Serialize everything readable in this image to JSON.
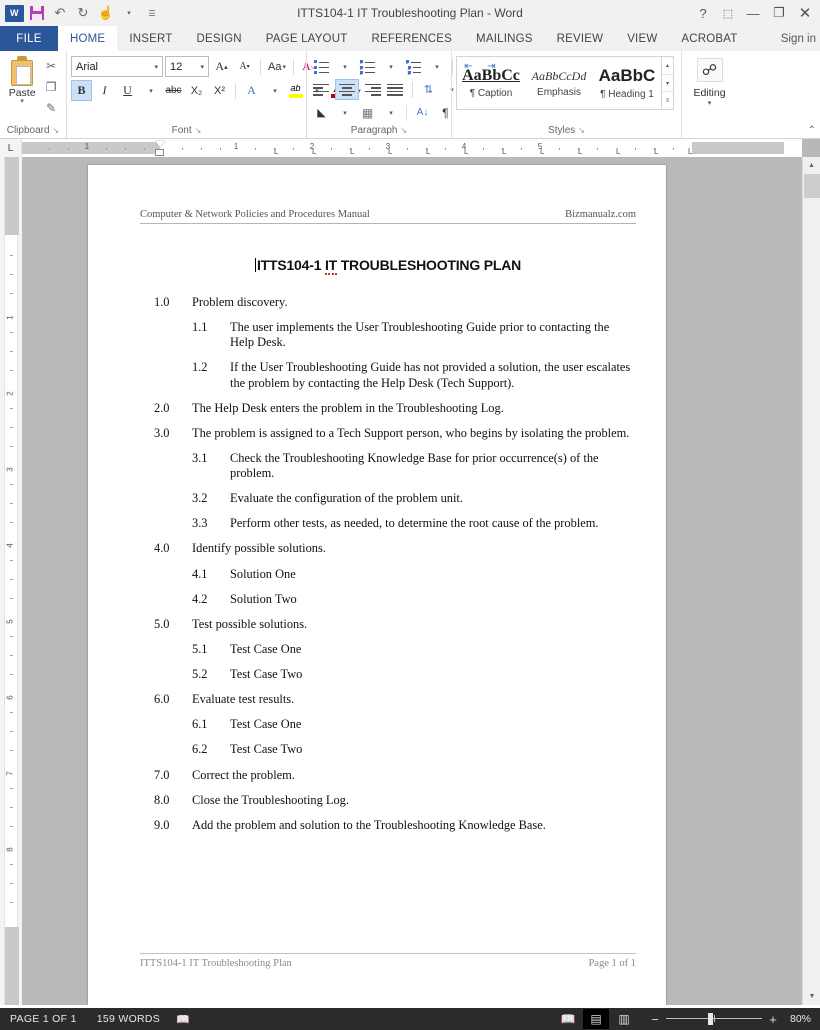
{
  "titlebar": {
    "document_title": "ITTS104-1 IT Troubleshooting Plan - Word",
    "quick_access": [
      {
        "name": "word-logo",
        "glyph": "W"
      },
      {
        "name": "save-icon",
        "glyph": ""
      },
      {
        "name": "undo-icon",
        "glyph": "↶"
      },
      {
        "name": "redo-icon",
        "glyph": "↻"
      },
      {
        "name": "touch-mode-icon",
        "glyph": "☝"
      },
      {
        "name": "customize-qat-icon",
        "glyph": "▾"
      }
    ],
    "help_glyph": "?",
    "ribbon_display_glyph": "⬚",
    "minimize_glyph": "—",
    "restore_glyph": "❐",
    "close_glyph": "✕"
  },
  "tabs": {
    "file_label": "FILE",
    "items": [
      {
        "label": "HOME",
        "active": true
      },
      {
        "label": "INSERT",
        "active": false
      },
      {
        "label": "DESIGN",
        "active": false
      },
      {
        "label": "PAGE LAYOUT",
        "active": false
      },
      {
        "label": "REFERENCES",
        "active": false
      },
      {
        "label": "MAILINGS",
        "active": false
      },
      {
        "label": "REVIEW",
        "active": false
      },
      {
        "label": "VIEW",
        "active": false
      },
      {
        "label": "ACROBAT",
        "active": false
      }
    ],
    "signin_label": "Sign in"
  },
  "ribbon": {
    "clipboard": {
      "group_label": "Clipboard",
      "paste_label": "Paste",
      "paste_caret": "▾",
      "cut_glyph": "✂",
      "copy_glyph": "❐",
      "format_painter_glyph": "✎",
      "dialog_launcher": "↘"
    },
    "font": {
      "group_label": "Font",
      "font_name": "Arial",
      "font_size": "12",
      "grow_font": "A",
      "shrink_font": "A",
      "change_case": "Aa",
      "clear_formatting": "A",
      "bold": "B",
      "italic": "I",
      "underline": "U",
      "strikethrough": "abc",
      "subscript": "X₂",
      "superscript": "X²",
      "text_effects": "A",
      "highlight": "ab",
      "font_color": "A",
      "dialog_launcher": "↘"
    },
    "paragraph": {
      "group_label": "Paragraph",
      "bullets": "bullets-icon",
      "numbering": "numbering-icon",
      "multilevel": "multilevel-list-icon",
      "decrease_indent": "⬅",
      "increase_indent": "➡",
      "align_left": "align-left-icon",
      "align_center": "align-center-icon",
      "align_right": "align-right-icon",
      "justify": "justify-icon",
      "line_spacing": "line-spacing-icon",
      "shading": "shading-icon",
      "borders": "borders-icon",
      "sort": "A↓",
      "show_marks": "¶",
      "dialog_launcher": "↘"
    },
    "styles": {
      "group_label": "Styles",
      "gallery": [
        {
          "preview": "AaBbCc",
          "name": "¶ Caption",
          "style": "cap"
        },
        {
          "preview": "AaBbCcDd",
          "name": "Emphasis",
          "style": "emph"
        },
        {
          "preview": "AaBbC",
          "name": "¶ Heading 1",
          "style": "h1"
        }
      ],
      "scroll_up": "▴",
      "scroll_down": "▾",
      "more": "≡",
      "dialog_launcher": "↘"
    },
    "editing": {
      "group_label": "Editing",
      "icon": "☍",
      "caret": "▾"
    },
    "collapse_glyph": "⌃"
  },
  "ruler": {
    "tab_selector_glyph": "L",
    "h_numbers": [
      "1",
      "1",
      "2",
      "3",
      "4",
      "5"
    ],
    "v_numbers": [
      "1",
      "2",
      "3",
      "4",
      "5",
      "6",
      "7",
      "8"
    ],
    "tab_mark_glyph": "L"
  },
  "scrollbar": {
    "up_arrow": "▲",
    "down_arrow": "▼"
  },
  "document": {
    "header_left": "Computer & Network Policies and Procedures Manual",
    "header_right": "Bizmanualz.com",
    "title": "ITTS104-1 IT TROUBLESHOOTING PLAN",
    "title_prefix": "ITTS104-1 ",
    "title_misspelled": "IT",
    "title_suffix": " TROUBLESHOOTING PLAN",
    "items": [
      {
        "level": 1,
        "num": "1.0",
        "text": "Problem discovery."
      },
      {
        "level": 2,
        "num": "1.1",
        "text": "The user implements the User Troubleshooting Guide prior to contacting the Help Desk."
      },
      {
        "level": 2,
        "num": "1.2",
        "text": "If the User Troubleshooting Guide has not provided a solution, the user escalates the problem by contacting the Help Desk (Tech Support)."
      },
      {
        "level": 1,
        "num": "2.0",
        "text": "The Help Desk enters the problem in the Troubleshooting Log."
      },
      {
        "level": 1,
        "num": "3.0",
        "text": "The problem is assigned to a Tech Support person, who begins by isolating the problem."
      },
      {
        "level": 2,
        "num": "3.1",
        "text": "Check the Troubleshooting Knowledge Base for prior occurrence(s) of the problem."
      },
      {
        "level": 2,
        "num": "3.2",
        "text": "Evaluate the configuration of the problem unit."
      },
      {
        "level": 2,
        "num": "3.3",
        "text": "Perform other tests, as needed, to determine the root cause of the problem."
      },
      {
        "level": 1,
        "num": "4.0",
        "text": "Identify possible solutions."
      },
      {
        "level": 2,
        "num": "4.1",
        "text": "Solution One"
      },
      {
        "level": 2,
        "num": "4.2",
        "text": "Solution Two"
      },
      {
        "level": 1,
        "num": "5.0",
        "text": "Test possible solutions."
      },
      {
        "level": 2,
        "num": "5.1",
        "text": "Test Case One"
      },
      {
        "level": 2,
        "num": "5.2",
        "text": "Test Case Two"
      },
      {
        "level": 1,
        "num": "6.0",
        "text": "Evaluate test results."
      },
      {
        "level": 2,
        "num": "6.1",
        "text": "Test Case One"
      },
      {
        "level": 2,
        "num": "6.2",
        "text": "Test Case Two"
      },
      {
        "level": 1,
        "num": "7.0",
        "text": "Correct the problem."
      },
      {
        "level": 1,
        "num": "8.0",
        "text": "Close the Troubleshooting Log."
      },
      {
        "level": 1,
        "num": "9.0",
        "text": "Add the problem and solution to the Troubleshooting Knowledge Base."
      }
    ],
    "footer_left": "ITTS104-1 IT Troubleshooting Plan",
    "footer_right": "Page 1 of 1"
  },
  "statusbar": {
    "page_label": "PAGE 1 OF 1",
    "word_count": "159 WORDS",
    "proofing_icon": "📖",
    "views": [
      {
        "name": "read-mode",
        "glyph": "📖",
        "active": false
      },
      {
        "name": "print-layout",
        "glyph": "▤",
        "active": true
      },
      {
        "name": "web-layout",
        "glyph": "▥",
        "active": false
      }
    ],
    "zoom_out": "−",
    "zoom_in": "+",
    "zoom_level": "80%"
  },
  "colors": {
    "word_blue": "#2b579a",
    "ribbon_bg": "#f1f1f1",
    "status_bg": "#2b2b2b",
    "workspace_gray": "#b8b8b8",
    "accent_selected": "#cde0f5"
  }
}
